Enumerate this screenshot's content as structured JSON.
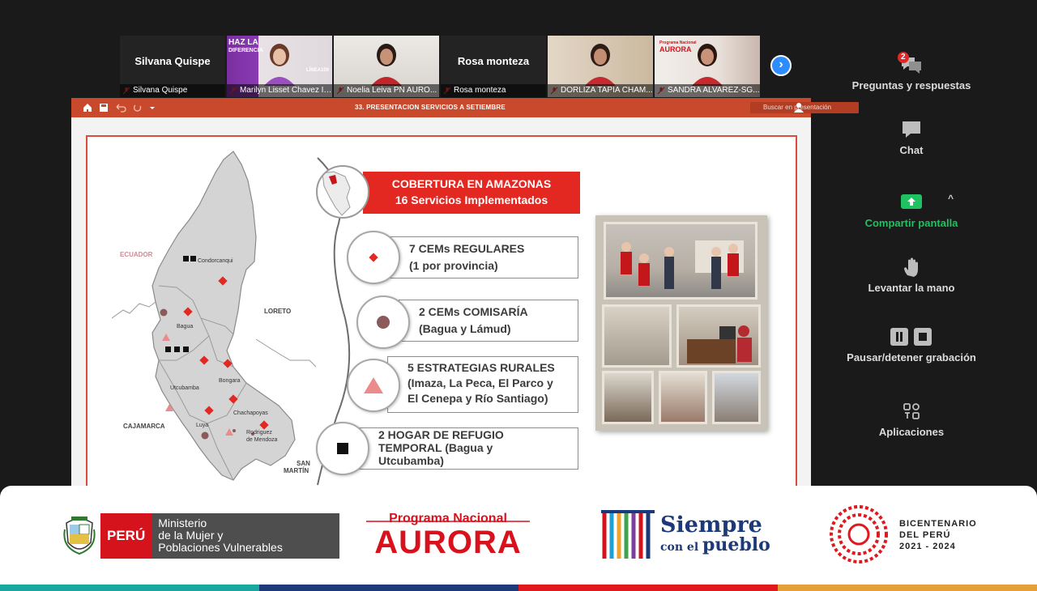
{
  "participants": [
    {
      "display_name": "Silvana Quispe",
      "caption": "Silvana Quispe",
      "video": false
    },
    {
      "display_name": "",
      "caption": "Marilyn Lisset Chavez Illes...",
      "video": true
    },
    {
      "display_name": "",
      "caption": "Noelia Leiva PN AURO...",
      "video": true
    },
    {
      "display_name": "Rosa monteza",
      "caption": "Rosa monteza",
      "video": false
    },
    {
      "display_name": "",
      "caption": "DORLIZA TAPIA CHAM...",
      "video": true
    },
    {
      "display_name": "",
      "caption": "SANDRA ALVAREZ-SG...",
      "video": true
    }
  ],
  "tile_overlays": {
    "haz_la": "HAZ LA",
    "diferencia": "DIFERENCIA",
    "linea": "LÍNEA100",
    "aurora_small_top": "Programa Nacional",
    "aurora_small": "AURORA"
  },
  "next_button": "›",
  "controls": {
    "qa": {
      "label": "Preguntas y respuestas",
      "badge": "2"
    },
    "chat": {
      "label": "Chat"
    },
    "share": {
      "label": "Compartir pantalla",
      "caret": "^"
    },
    "raise": {
      "label": "Levantar la mano"
    },
    "record": {
      "label": "Pausar/detener grabación"
    },
    "apps": {
      "label": "Aplicaciones"
    }
  },
  "ppt": {
    "title": "33. PRESENTACION SERVICIOS A SETIEMBRE",
    "search_placeholder": "Buscar en presentación"
  },
  "slide": {
    "banner_line1": "COBERTURA EN AMAZONAS",
    "banner_line2": "16 Servicios Implementados",
    "items": [
      {
        "line1": "7 CEMs REGULARES",
        "line2": "(1 por provincia)",
        "marker": "diamond"
      },
      {
        "line1": "2 CEMs COMISARÍA",
        "line2": "(Bagua y Lámud)",
        "marker": "dot"
      },
      {
        "line1": "5 ESTRATEGIAS RURALES",
        "line2": "(Imaza, La Peca, El Parco y",
        "line3": "El Cenepa y Río Santiago)",
        "marker": "triangle"
      },
      {
        "line1": "2 HOGAR DE REFUGIO",
        "line2": "TEMPORAL (Bagua y",
        "line3": "Utcubamba)",
        "marker": "square"
      }
    ],
    "map_labels": {
      "ecuador": "ECUADOR",
      "loreto": "LORETO",
      "cajamarca": "CAJAMARCA",
      "san_martin_1": "SAN",
      "san_martin_2": "MARTÍN",
      "condorcanqui": "Condorcanqui",
      "bagua": "Bagua",
      "bongara": "Bongara",
      "utcubamba": "Utcubamba",
      "luya": "Luya",
      "chachapoyas": "Chachapoyas",
      "rodriguez_1": "Rodriguez",
      "rodriguez_2": "de Mendoza"
    }
  },
  "footer": {
    "peru": "PERÚ",
    "ministerio_1": "Ministerio",
    "ministerio_2": "de la Mujer y",
    "ministerio_3": "Poblaciones Vulnerables",
    "programa": "Programa Nacional",
    "aurora": "AURORA",
    "siempre": "Siempre",
    "con_el": "con el",
    "pueblo": "pueblo",
    "bicent_1": "BICENTENARIO",
    "bicent_2": "DEL PERÚ",
    "bicent_3": "2021 - 2024"
  },
  "colors": {
    "accent_red": "#e32822",
    "ppt_bar": "#c8492c",
    "zoom_blue": "#2d8cff",
    "share_green": "#20c160"
  }
}
